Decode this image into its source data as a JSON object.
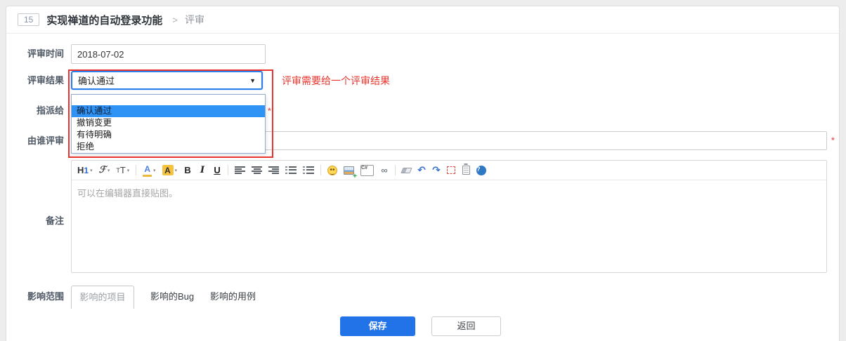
{
  "header": {
    "badge": "15",
    "title": "实现禅道的自动登录功能",
    "separator": ">",
    "crumb": "评审"
  },
  "form": {
    "review_time": {
      "label": "评审时间",
      "value": "2018-07-02"
    },
    "review_result": {
      "label": "评审结果",
      "selected": "确认通过",
      "arrow": "▼",
      "options": [
        "",
        "确认通过",
        "撤销变更",
        "有待明确",
        "拒绝"
      ]
    },
    "assigned_to": {
      "label": "指派给",
      "required_mark": "*"
    },
    "reviewed_by": {
      "label": "由谁评审",
      "value": "",
      "required_mark": "*"
    },
    "comment": {
      "label": "备注",
      "placeholder": "可以在编辑器直接贴图。"
    },
    "scope": {
      "label": "影响范围",
      "tabs": [
        "影响的项目",
        "影响的Bug",
        "影响的用例"
      ],
      "active_tab": "影响的项目"
    },
    "buttons": {
      "save": "保存",
      "back": "返回"
    }
  },
  "annotation": {
    "text": "评审需要给一个评审结果",
    "color": "#e8342c"
  },
  "editor_toolbar": {
    "heading_h": "H",
    "heading_1": "1",
    "caret": "▾",
    "font_family": "ℱ",
    "font_size_small": "T",
    "font_size_large": "T",
    "fore_color": "A",
    "hilite_color": "A",
    "bold": "B",
    "italic": "I",
    "underline": "U",
    "code": "C#",
    "link": "∞",
    "undo": "↶",
    "redo": "↷",
    "help": "?"
  },
  "colors": {
    "save_button_blue": "#2373e8",
    "dropdown_highlight_blue": "#2f93f6",
    "select_focus_blue": "#2b7de9",
    "annotation_red": "#e8342c",
    "required_mark_red": "#e26868"
  }
}
